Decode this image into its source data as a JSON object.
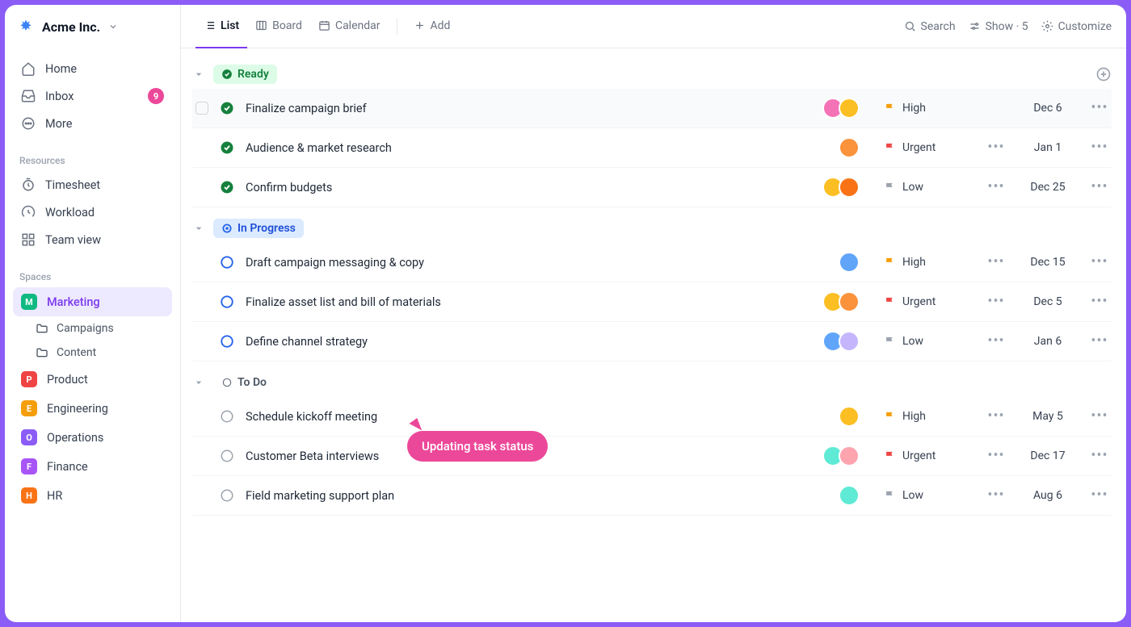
{
  "workspace": "Acme Inc.",
  "sidebar": {
    "nav": [
      {
        "label": "Home",
        "icon": "home"
      },
      {
        "label": "Inbox",
        "icon": "inbox",
        "badge": "9"
      },
      {
        "label": "More",
        "icon": "more"
      }
    ],
    "section_resources": "Resources",
    "resources": [
      {
        "label": "Timesheet",
        "icon": "timer"
      },
      {
        "label": "Workload",
        "icon": "gauge"
      },
      {
        "label": "Team view",
        "icon": "grid"
      }
    ],
    "section_spaces": "Spaces",
    "spaces": [
      {
        "letter": "M",
        "label": "Marketing",
        "color": "#10b981",
        "active": true
      },
      {
        "letter": "P",
        "label": "Product",
        "color": "#ef4444"
      },
      {
        "letter": "E",
        "label": "Engineering",
        "color": "#f59e0b"
      },
      {
        "letter": "O",
        "label": "Operations",
        "color": "#8b5cf6"
      },
      {
        "letter": "F",
        "label": "Finance",
        "color": "#a855f7"
      },
      {
        "letter": "H",
        "label": "HR",
        "color": "#f97316"
      }
    ],
    "subfolders": [
      {
        "label": "Campaigns"
      },
      {
        "label": "Content"
      }
    ]
  },
  "topbar": {
    "views": [
      {
        "label": "List",
        "icon": "list",
        "active": true
      },
      {
        "label": "Board",
        "icon": "board"
      },
      {
        "label": "Calendar",
        "icon": "calendar"
      }
    ],
    "add": "Add",
    "search": "Search",
    "show": "Show · 5",
    "customize": "Customize"
  },
  "groups": [
    {
      "id": "ready",
      "label": "Ready",
      "pill": "ready",
      "statusIcon": "check-filled",
      "tasks": [
        {
          "title": "Finalize campaign brief",
          "status": "done",
          "assignees": [
            "#f472b6",
            "#fbbf24"
          ],
          "priority": "High",
          "flagColor": "#f59e0b",
          "date": "Dec 6",
          "hovered": true,
          "subtasks": false
        },
        {
          "title": "Audience & market research",
          "status": "done",
          "assignees": [
            "#fb923c"
          ],
          "priority": "Urgent",
          "flagColor": "#ef4444",
          "date": "Jan 1",
          "subtasks": true
        },
        {
          "title": "Confirm budgets",
          "status": "done",
          "assignees": [
            "#fbbf24",
            "#f97316"
          ],
          "priority": "Low",
          "flagColor": "#9ca3af",
          "date": "Dec 25",
          "subtasks": true
        }
      ]
    },
    {
      "id": "inprogress",
      "label": "In Progress",
      "pill": "inprogress",
      "statusIcon": "ring",
      "tasks": [
        {
          "title": "Draft campaign messaging & copy",
          "status": "progress",
          "assignees": [
            "#60a5fa"
          ],
          "priority": "High",
          "flagColor": "#f59e0b",
          "date": "Dec 15",
          "subtasks": true
        },
        {
          "title": "Finalize asset list and bill of materials",
          "status": "progress",
          "assignees": [
            "#fbbf24",
            "#fb923c"
          ],
          "priority": "Urgent",
          "flagColor": "#ef4444",
          "date": "Dec 5",
          "subtasks": true
        },
        {
          "title": "Define channel strategy",
          "status": "progress",
          "assignees": [
            "#60a5fa",
            "#c4b5fd"
          ],
          "priority": "Low",
          "flagColor": "#9ca3af",
          "date": "Jan 6",
          "subtasks": true
        }
      ]
    },
    {
      "id": "todo",
      "label": "To Do",
      "pill": "todo",
      "statusIcon": "circle",
      "tasks": [
        {
          "title": "Schedule kickoff meeting",
          "status": "todo",
          "assignees": [
            "#fbbf24"
          ],
          "priority": "High",
          "flagColor": "#f59e0b",
          "date": "May 5",
          "subtasks": true
        },
        {
          "title": "Customer Beta interviews",
          "status": "todo",
          "assignees": [
            "#5eead4",
            "#fda4af"
          ],
          "priority": "Urgent",
          "flagColor": "#ef4444",
          "date": "Dec 17",
          "subtasks": true
        },
        {
          "title": "Field marketing support plan",
          "status": "todo",
          "assignees": [
            "#5eead4"
          ],
          "priority": "Low",
          "flagColor": "#9ca3af",
          "date": "Aug 6",
          "subtasks": true
        }
      ]
    }
  ],
  "tooltip": "Updating task status"
}
